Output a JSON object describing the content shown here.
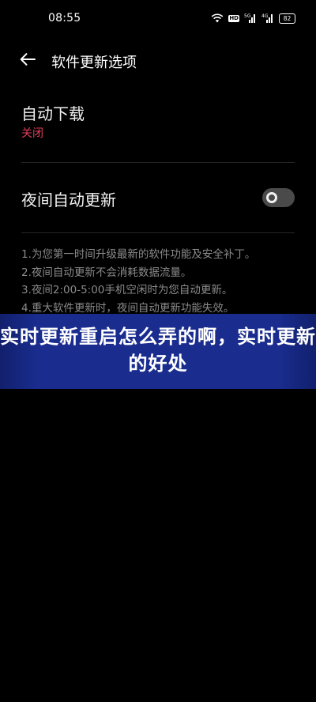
{
  "status_bar": {
    "time": "08:55",
    "hd_label": "HD",
    "signal_1_label": "5G",
    "signal_2_label": "4G",
    "battery_level": "82"
  },
  "header": {
    "title": "软件更新选项"
  },
  "settings": {
    "auto_download": {
      "label": "自动下载",
      "value": "关闭"
    },
    "night_update": {
      "label": "夜间自动更新",
      "enabled": false
    }
  },
  "notes": [
    "1.为您第一时间升级最新的软件功能及安全补丁。",
    "2.夜间自动更新不会消耗数据流量。",
    "3.夜间2:00-5:00手机空闲时为您自动更新。",
    "4.重大软件更新时，夜间自动更新功能失效。"
  ],
  "overlay": {
    "headline": "实时更新重启怎么弄的啊，实时更新的好处"
  },
  "colors": {
    "background": "#000000",
    "accent_red": "#e0405c",
    "banner_blue": "#1a2d8f",
    "note_gray": "#8a8a8a"
  }
}
